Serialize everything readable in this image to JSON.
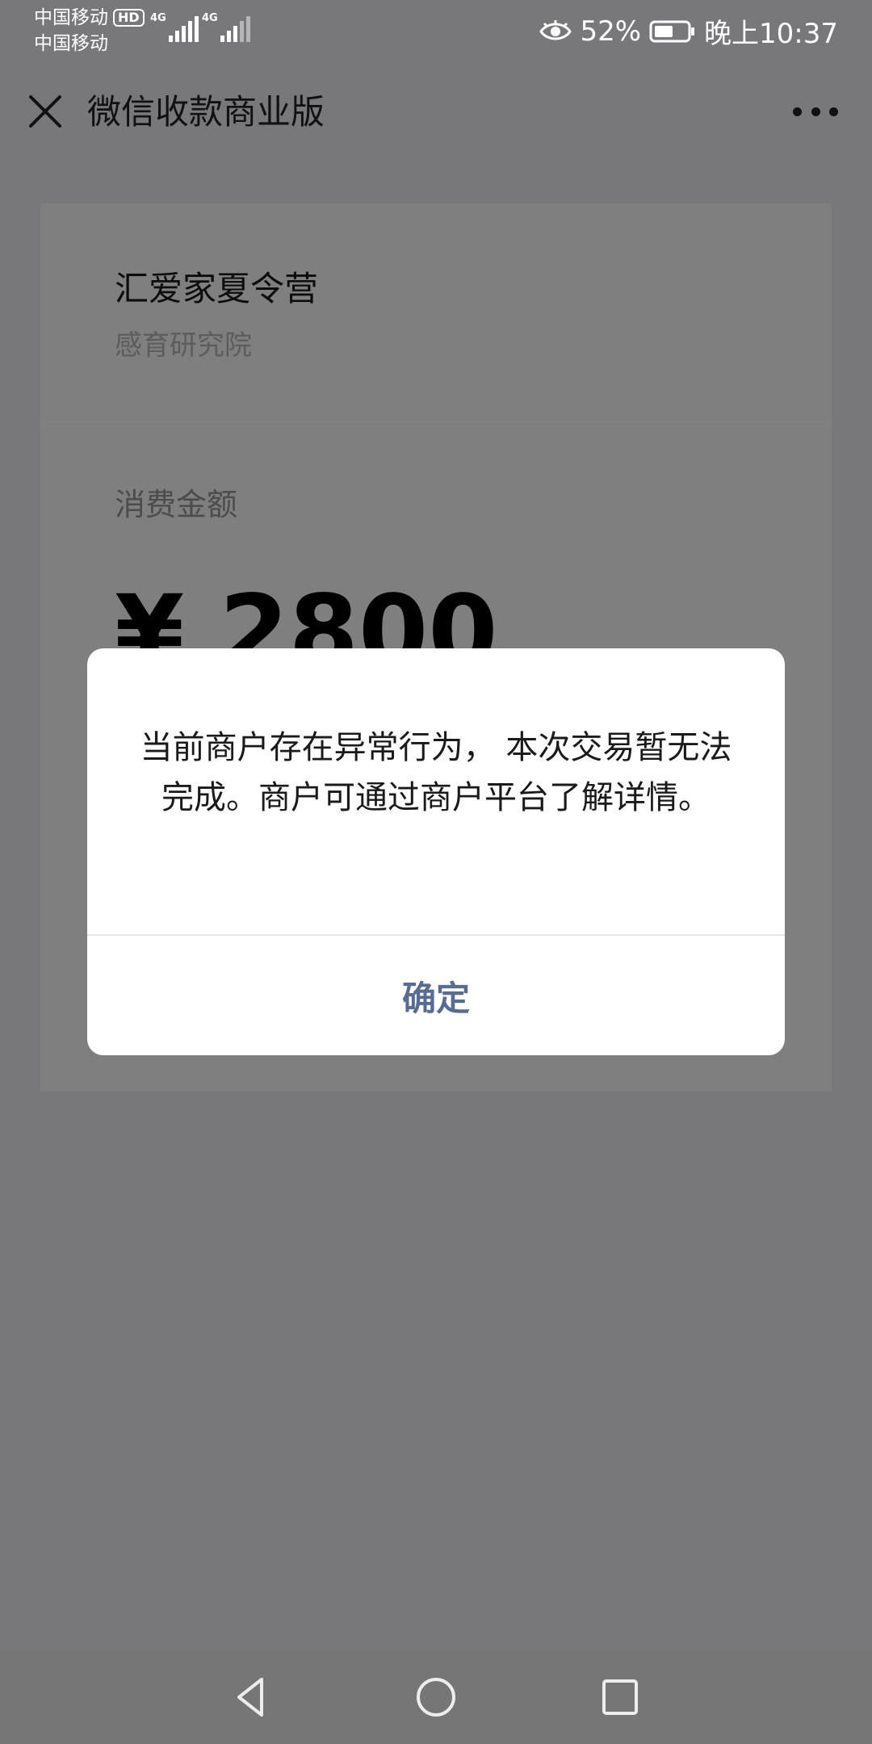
{
  "status_bar": {
    "carrier_1": "中国移动",
    "hd_badge": "HD",
    "carrier_2": "中国移动",
    "network_1": "4G",
    "network_2": "4G",
    "battery_percent": "52%",
    "time": "晚上10:37",
    "icons": [
      "eye-icon",
      "battery-icon",
      "signal-icon"
    ]
  },
  "nav_bar": {
    "title": "微信收款商业版",
    "icons": [
      "close-icon",
      "more-icon"
    ]
  },
  "card": {
    "merchant_name": "汇爱家夏令营",
    "merchant_org": "感育研究院",
    "amount_label": "消费金额",
    "amount_value": "¥ 2800"
  },
  "dialog": {
    "message": "当前商户存在异常行为， 本次交易暂无法完成。商户可通过商户平台了解详情。",
    "confirm_label": "确定",
    "confirm_color": "#576b95"
  },
  "system_nav": {
    "icons": [
      "back-triangle-icon",
      "home-circle-icon",
      "recents-square-icon"
    ]
  },
  "colors": {
    "overlay_background": "#78787a",
    "dialog_background": "#ffffff",
    "link_blue": "#576b95"
  }
}
